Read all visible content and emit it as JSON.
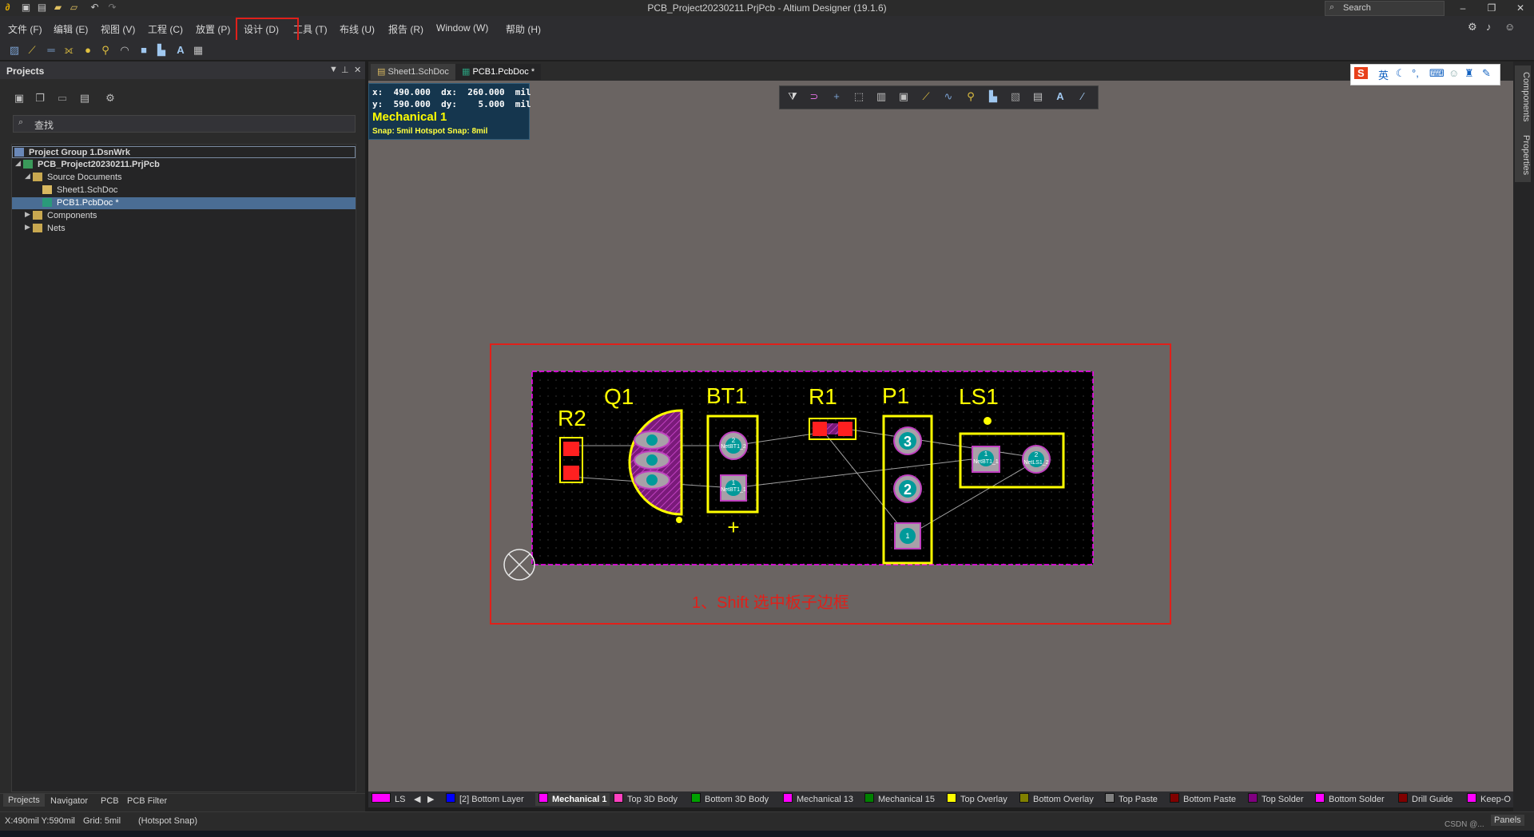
{
  "window": {
    "title": "PCB_Project20230211.PrjPcb - Altium Designer (19.1.6)",
    "search_label": "Search",
    "minimize": "–",
    "restore": "❐",
    "close": "✕"
  },
  "menu": [
    "文件 (F)",
    "编辑 (E)",
    "视图 (V)",
    "工程 (C)",
    "放置 (P)",
    "设计 (D)",
    "工具 (T)",
    "布线 (U)",
    "报告 (R)",
    "Window (W)",
    "帮助 (H)"
  ],
  "projects_panel": {
    "title": "Projects",
    "search_placeholder": "查找",
    "tree": [
      {
        "label": "Project Group 1.DsnWrk",
        "level": 0,
        "bold": true
      },
      {
        "label": "PCB_Project20230211.PrjPcb",
        "level": 1,
        "bold": true
      },
      {
        "label": "Source Documents",
        "level": 2
      },
      {
        "label": "Sheet1.SchDoc",
        "level": 3
      },
      {
        "label": "PCB1.PcbDoc *",
        "level": 3,
        "selected": true
      },
      {
        "label": "Components",
        "level": 2
      },
      {
        "label": "Nets",
        "level": 2
      }
    ],
    "bottom_tabs": [
      "Projects",
      "Navigator",
      "PCB",
      "PCB Filter"
    ]
  },
  "doc_tabs": [
    "Sheet1.SchDoc",
    "PCB1.PcbDoc *"
  ],
  "coords": {
    "x_line": "x:  490.000  dx:  260.000  mil",
    "y_line": "y:  590.000  dy:    5.000  mil",
    "layer": "Mechanical 1",
    "snap": "Snap: 5mil Hotspot Snap: 8mil"
  },
  "pcb": {
    "designators": [
      "R2",
      "Q1",
      "BT1",
      "R1",
      "P1",
      "LS1"
    ],
    "pad_labels": {
      "bt1_pad2": "NetBT1_2",
      "bt1_pad1": "NetBT1_1",
      "ls1_pad1": "NetBT1_1",
      "ls1_pad2": "NetLS1_2",
      "p1_pad3": "3",
      "p1_pad2": "2",
      "p1_pad1": "1"
    },
    "pad_numbers": {
      "two": "2",
      "one": "1"
    },
    "plus_mark": "+"
  },
  "annotation": "1、Shift 选中板子边框",
  "ime": {
    "logo": "S",
    "lang": "英"
  },
  "right_tabs": [
    "Components",
    "Properties"
  ],
  "layers": [
    {
      "label": "LS",
      "color": "#ff00ff"
    },
    {
      "label": "[2] Bottom Layer",
      "color": "#0000ff"
    },
    {
      "label": "Mechanical 1",
      "color": "#ff00ff",
      "active": true
    },
    {
      "label": "Top 3D Body",
      "color": "#ff40c0"
    },
    {
      "label": "Bottom 3D Body",
      "color": "#00a000"
    },
    {
      "label": "Mechanical 13",
      "color": "#ff00ff"
    },
    {
      "label": "Mechanical 15",
      "color": "#008000"
    },
    {
      "label": "Top Overlay",
      "color": "#ffff00"
    },
    {
      "label": "Bottom Overlay",
      "color": "#808000"
    },
    {
      "label": "Top Paste",
      "color": "#808080"
    },
    {
      "label": "Bottom Paste",
      "color": "#800000"
    },
    {
      "label": "Top Solder",
      "color": "#800080"
    },
    {
      "label": "Bottom Solder",
      "color": "#ff00ff"
    },
    {
      "label": "Drill Guide",
      "color": "#800000"
    },
    {
      "label": "Keep-O",
      "color": "#ff00ff"
    }
  ],
  "status": {
    "position": "X:490mil Y:590mil",
    "grid": "Grid: 5mil",
    "snap": "(Hotspot Snap)",
    "panels": "Panels",
    "watermark": "CSDN @..."
  }
}
